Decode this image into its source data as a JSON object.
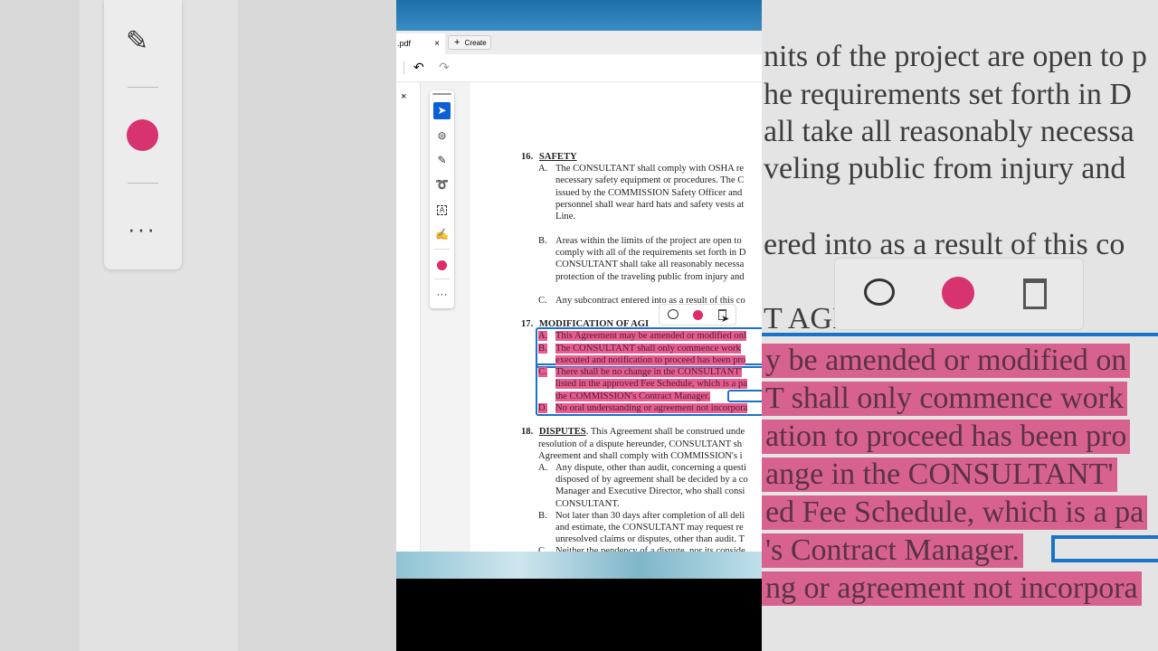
{
  "tab": {
    "filename": ".pdf",
    "close": "×",
    "create_label": "Create",
    "create_icon": "+"
  },
  "toolbar": {
    "undo": "↶",
    "redo": "↷"
  },
  "panel": {
    "close": "×"
  },
  "tools": [
    "select-tool",
    "comment-tool",
    "draw-tool",
    "lasso-tool",
    "text-select-tool",
    "fill-sign-tool",
    "color",
    "more"
  ],
  "colors": {
    "highlight": "#e85c8f",
    "accent": "#0d5fd6",
    "selection": "#1a73c8"
  },
  "doc": {
    "s16_num": "16.",
    "s16_title": "SAFETY",
    "s16": [
      [
        "A.",
        "The CONSULTANT shall comply with OSHA re"
      ],
      [
        "",
        "necessary safety equipment or procedures.  The C"
      ],
      [
        "",
        "issued by the COMMISSION Safety Officer and"
      ],
      [
        "",
        "personnel shall wear hard hats and safety vests at"
      ],
      [
        "",
        "Line."
      ],
      [
        "B.",
        "Areas within the limits of the project are open to"
      ],
      [
        "",
        "comply with all of the requirements set forth in D"
      ],
      [
        "",
        "CONSULTANT shall take all reasonably necessa"
      ],
      [
        "",
        "protection of the traveling public from injury and"
      ],
      [
        "C.",
        "Any subcontract entered into as a result of this co"
      ]
    ],
    "s17_num": "17.",
    "s17_title": "MODIFICATION OF AGI",
    "s17": [
      [
        "A.",
        "This Agreement may be amended or modified onl"
      ],
      [
        "B.",
        "The CONSULTANT shall only commence work"
      ],
      [
        "",
        "executed and notification to proceed has been pro"
      ],
      [
        "C.",
        "There shall be no change in the CONSULTANT'"
      ],
      [
        "",
        "listed in the approved Fee Schedule, which is a pa"
      ],
      [
        "",
        "the COMMISSION's Contract Manager."
      ],
      [
        "D.",
        "No oral understanding or agreement not incorpora"
      ]
    ],
    "s18_num": "18.",
    "s18_title": "DISPUTES",
    "s18_intro": [
      ". This Agreement shall be construed unde",
      "resolution of a dispute hereunder, CONSULTANT sh",
      "Agreement and shall comply with COMMISSION's i"
    ],
    "s18": [
      [
        "A.",
        "Any dispute, other than audit, concerning a questi"
      ],
      [
        "",
        "disposed of by agreement shall be decided by a co"
      ],
      [
        "",
        "Manager and Executive Director, who shall consi"
      ],
      [
        "",
        "CONSULTANT."
      ],
      [
        "B.",
        "Not later than 30 days after completion of all deli"
      ],
      [
        "",
        "and estimate, the CONSULTANT may request re"
      ],
      [
        "",
        "unresolved claims or disputes, other than audit. T"
      ],
      [
        "C.",
        "Neither the pendency of a dispute, nor its conside"
      ]
    ]
  },
  "zoomed": {
    "lines": [
      "nits of the project are open to p",
      "he requirements set forth in D",
      "all take all reasonably necessa",
      "veling public from injury and",
      "ered into as a result of this co",
      "T AGI"
    ],
    "highlights": [
      "y be amended or modified on",
      "T shall only commence work",
      "ation to proceed has been pro",
      "ange in the CONSULTANT'",
      "ed Fee Schedule, which is a pa",
      "'s Contract Manager.",
      "ng or agreement not incorpora"
    ]
  }
}
